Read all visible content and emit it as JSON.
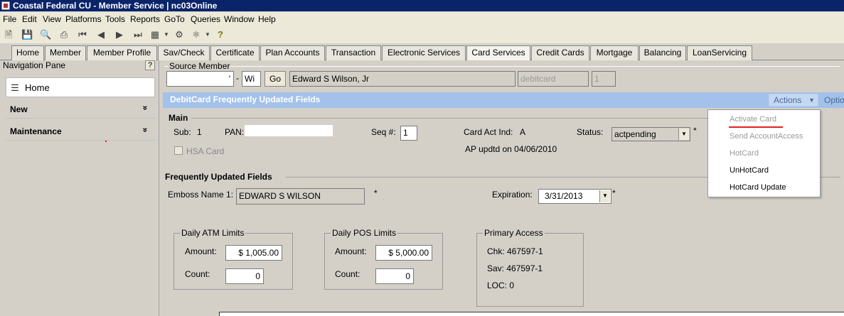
{
  "title": "Coastal Federal CU - Member Service | nc03Online",
  "menu": [
    "File",
    "Edit",
    "View",
    "Platforms",
    "Tools",
    "Reports",
    "GoTo",
    "Queries",
    "Window",
    "Help"
  ],
  "toolbar_icons": [
    "new-icon",
    "save-icon",
    "preview-icon",
    "print-icon",
    "first-icon",
    "prev-icon",
    "next-icon",
    "last-icon",
    "calendar-icon",
    "settings-icon",
    "network-icon",
    "help-icon"
  ],
  "tabs": [
    "Home",
    "Member",
    "Member Profile",
    "Sav/Check",
    "Certificate",
    "Plan Accounts",
    "Transaction",
    "Electronic Services",
    "Card Services",
    "Credit Cards",
    "Mortgage",
    "Balancing",
    "LoanServicing"
  ],
  "active_tab": "Card Services",
  "nav": {
    "title": "Navigation Pane",
    "help": "?",
    "home": "Home",
    "sections": [
      "New",
      "Maintenance"
    ],
    "chevron": "»"
  },
  "source_member": {
    "label": "Source Member",
    "account": "'",
    "dash": "-",
    "suffix": "Wi",
    "go": "Go",
    "name": "Edward S Wilson, Jr",
    "type": "debitcard",
    "index": "1"
  },
  "banner": {
    "title": "DebitCard Frequently Updated Fields",
    "actions": "Actions",
    "options": "Optio"
  },
  "main": {
    "header": "Main",
    "sub_label": "Sub:",
    "sub_value": "1",
    "pan_label": "PAN:",
    "pan_value": "",
    "seq_label": "Seq #:",
    "seq_value": "1",
    "card_act_label": "Card Act Ind:",
    "card_act_value": "A",
    "status_label": "Status:",
    "status_value": "actpending",
    "required": "*",
    "hsa_label": "HSA Card",
    "ap_updated": "AP updtd on 04/06/2010"
  },
  "frequent": {
    "header": "Frequently Updated Fields",
    "emboss_label": "Emboss Name 1:",
    "emboss_value": "EDWARD S WILSON",
    "expiration_label": "Expiration:",
    "expiration_value": "3/31/2013"
  },
  "atm": {
    "legend": "Daily ATM Limits",
    "amount_label": "Amount:",
    "amount": "$ 1,005.00",
    "count_label": "Count:",
    "count": "0"
  },
  "pos": {
    "legend": "Daily POS Limits",
    "amount_label": "Amount:",
    "amount": "$ 5,000.00",
    "count_label": "Count:",
    "count": "0"
  },
  "primary": {
    "legend": "Primary Access",
    "chk": "Chk: 467597-1",
    "sav": "Sav: 467597-1",
    "loc": "LOC: 0"
  },
  "actions_menu": [
    {
      "label": "Activate Card",
      "enabled": false
    },
    {
      "label": "Send AccountAccess",
      "enabled": false
    },
    {
      "label": "HotCard",
      "enabled": false
    },
    {
      "label": "UnHotCard",
      "enabled": true
    },
    {
      "label": "HotCard Update",
      "enabled": true
    }
  ],
  "colors": {
    "title_bar": "#0a246a",
    "banner": "#a3c1ea",
    "highlight_underline": "#e02020"
  }
}
